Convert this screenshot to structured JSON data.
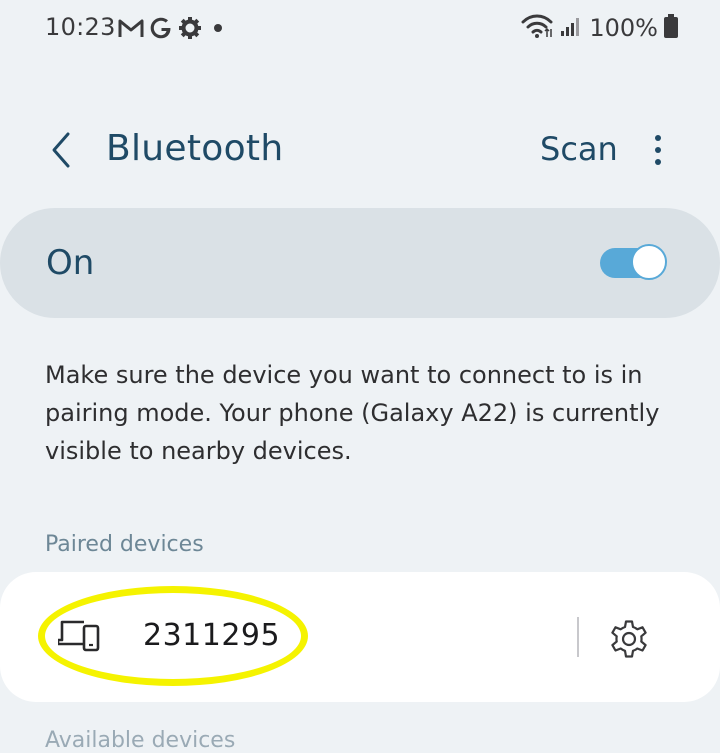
{
  "status_bar": {
    "time": "10:23",
    "battery": "100%",
    "left_icons": [
      "gmail-icon",
      "google-icon",
      "settings-gear-icon",
      "dot-icon"
    ],
    "right_icons": [
      "wifi-icon",
      "signal-icon",
      "battery-icon"
    ]
  },
  "header": {
    "title": "Bluetooth",
    "scan_label": "Scan"
  },
  "toggle": {
    "label": "On",
    "state": "on"
  },
  "description": "Make sure the device you want to connect to is in pairing mode. Your phone (Galaxy A22) is currently visible to nearby devices.",
  "paired_section": {
    "header": "Paired devices",
    "devices": [
      {
        "name": "2311295",
        "icon": "devices-icon"
      }
    ]
  },
  "available_section": {
    "header": "Available devices"
  },
  "colors": {
    "background": "#eef2f5",
    "accent": "#1f4a66",
    "switch_on": "#58a9d8",
    "highlight": "#f5f300"
  }
}
